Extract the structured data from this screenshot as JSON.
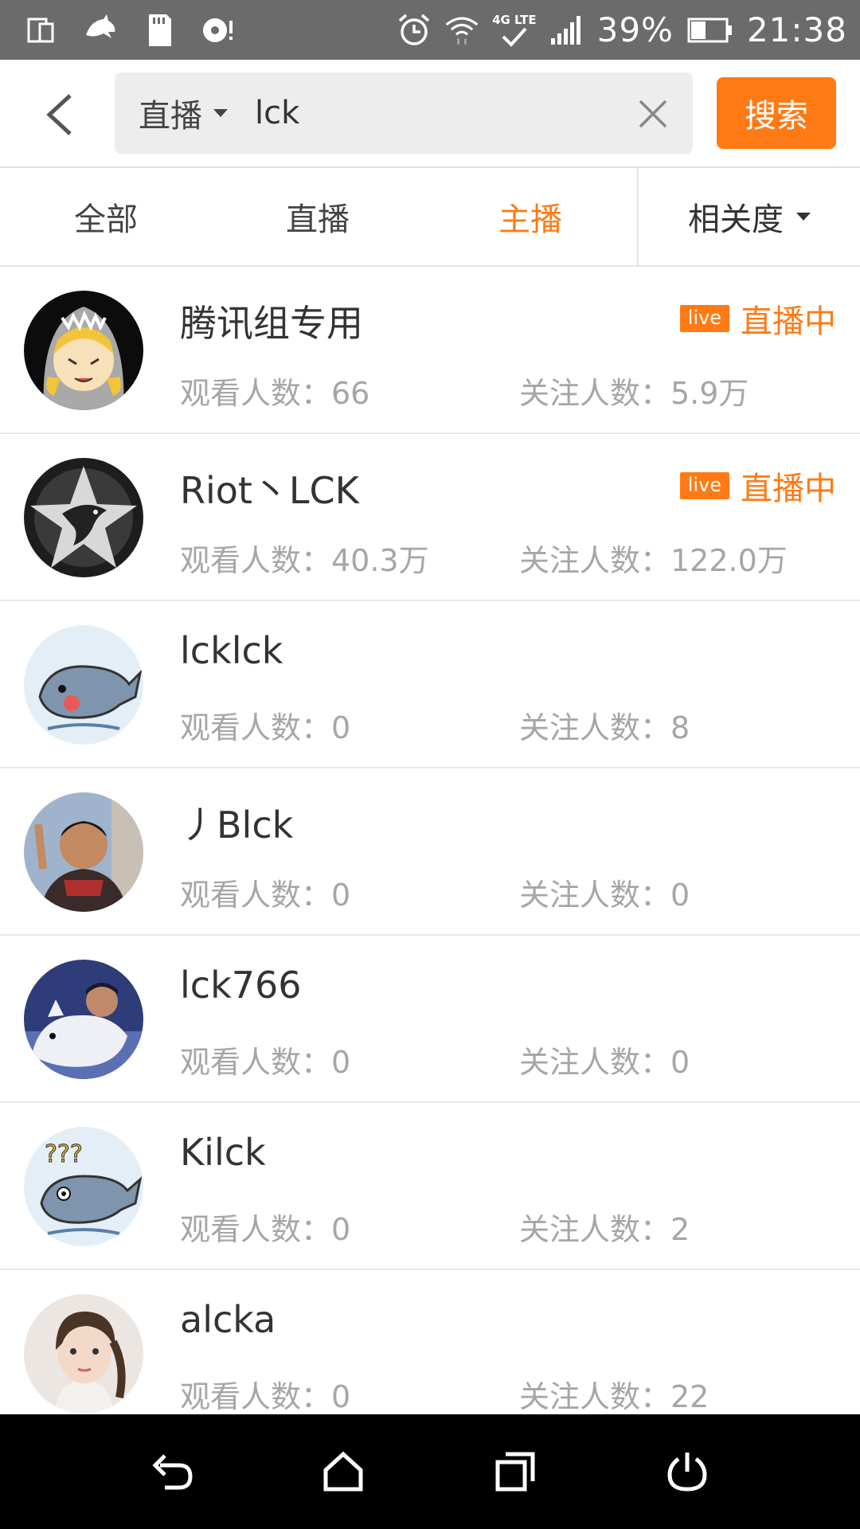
{
  "status_bar": {
    "network_label": "4G LTE",
    "battery": "39%",
    "time": "21:38"
  },
  "header": {
    "scope": "直播",
    "query": "lck",
    "search_label": "搜索"
  },
  "tabs": [
    {
      "label": "全部",
      "active": false
    },
    {
      "label": "直播",
      "active": false
    },
    {
      "label": "主播",
      "active": true
    }
  ],
  "sort": {
    "label": "相关度"
  },
  "results": [
    {
      "name": "腾讯组专用",
      "viewers": "观看人数：66",
      "followers": "关注人数：5.9万",
      "live": true,
      "live_badge": "live",
      "live_text": "直播中"
    },
    {
      "name": "Riot丶LCK",
      "viewers": "观看人数：40.3万",
      "followers": "关注人数：122.0万",
      "live": true,
      "live_badge": "live",
      "live_text": "直播中"
    },
    {
      "name": "lcklck",
      "viewers": "观看人数：0",
      "followers": "关注人数：8",
      "live": false
    },
    {
      "name": "丿Blck",
      "viewers": "观看人数：0",
      "followers": "关注人数：0",
      "live": false
    },
    {
      "name": "lck766",
      "viewers": "观看人数：0",
      "followers": "关注人数：0",
      "live": false
    },
    {
      "name": "Kilck",
      "viewers": "观看人数：0",
      "followers": "关注人数：2",
      "live": false
    },
    {
      "name": "alcka",
      "viewers": "观看人数：0",
      "followers": "关注人数：22",
      "live": false
    }
  ],
  "colors": {
    "accent": "#ff7a14",
    "status_bar": "#6b6b6b",
    "nav_bar": "#000000"
  },
  "icons": {
    "back": "chevron-left-icon",
    "clear": "close-icon",
    "nav_back": "undo-arrow-icon",
    "nav_home": "home-icon",
    "nav_recents": "recents-icon",
    "nav_power": "power-icon"
  }
}
